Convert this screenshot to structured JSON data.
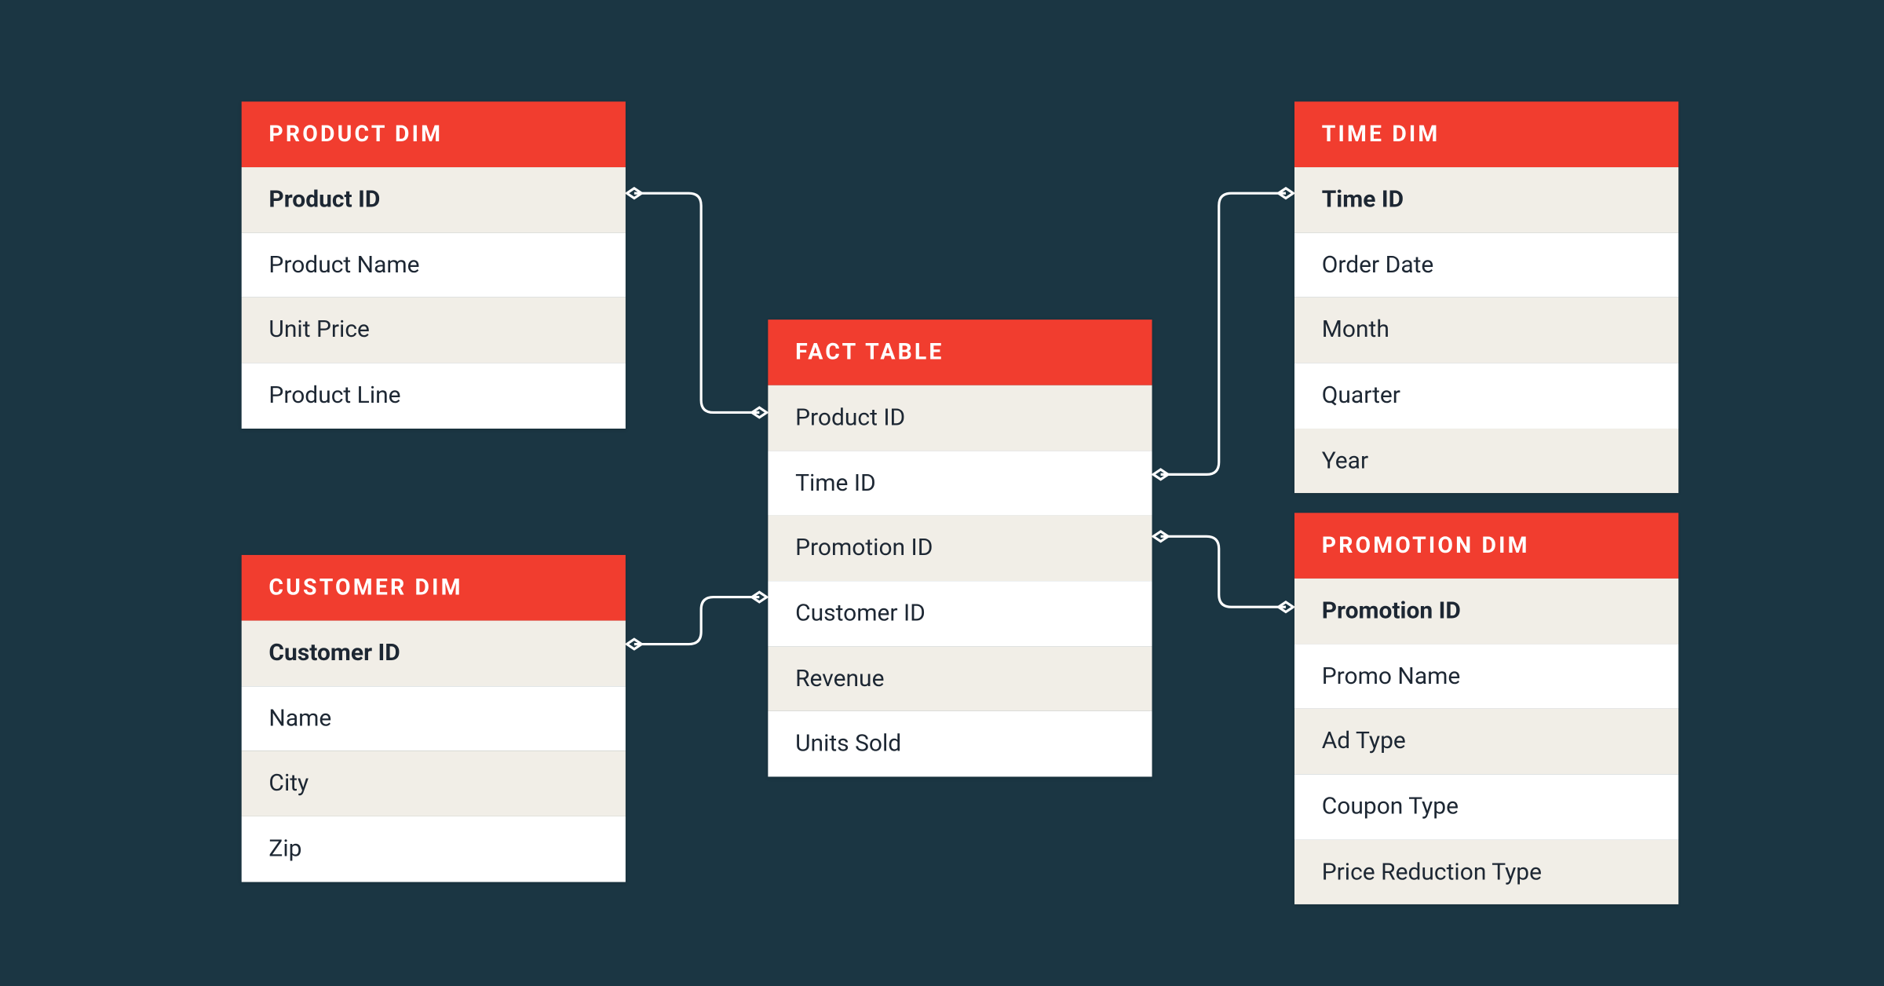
{
  "diagram_type": "star-schema",
  "tables": {
    "product": {
      "title": "PRODUCT DIM",
      "fields": [
        "Product ID",
        "Product Name",
        "Unit Price",
        "Product Line"
      ],
      "primary_key": "Product ID"
    },
    "time": {
      "title": "TIME DIM",
      "fields": [
        "Time ID",
        "Order Date",
        "Month",
        "Quarter",
        "Year"
      ],
      "primary_key": "Time ID"
    },
    "customer": {
      "title": "CUSTOMER DIM",
      "fields": [
        "Customer ID",
        "Name",
        "City",
        "Zip"
      ],
      "primary_key": "Customer ID"
    },
    "promotion": {
      "title": "PROMOTION DIM",
      "fields": [
        "Promotion ID",
        "Promo Name",
        "Ad Type",
        "Coupon Type",
        "Price Reduction Type"
      ],
      "primary_key": "Promotion ID"
    },
    "fact": {
      "title": "FACT TABLE",
      "fields": [
        "Product ID",
        "Time ID",
        "Promotion ID",
        "Customer ID",
        "Revenue",
        "Units Sold"
      ],
      "primary_key": null
    }
  },
  "relationships": [
    {
      "from": "product.Product ID",
      "to": "fact.Product ID"
    },
    {
      "from": "time.Time ID",
      "to": "fact.Time ID"
    },
    {
      "from": "customer.Customer ID",
      "to": "fact.Customer ID"
    },
    {
      "from": "promotion.Promotion ID",
      "to": "fact.Promotion ID"
    }
  ],
  "colors": {
    "background": "#1b3643",
    "header": "#f13d2f",
    "row_alt": "#f1eee7",
    "row": "#ffffff",
    "connector": "#ffffff"
  }
}
